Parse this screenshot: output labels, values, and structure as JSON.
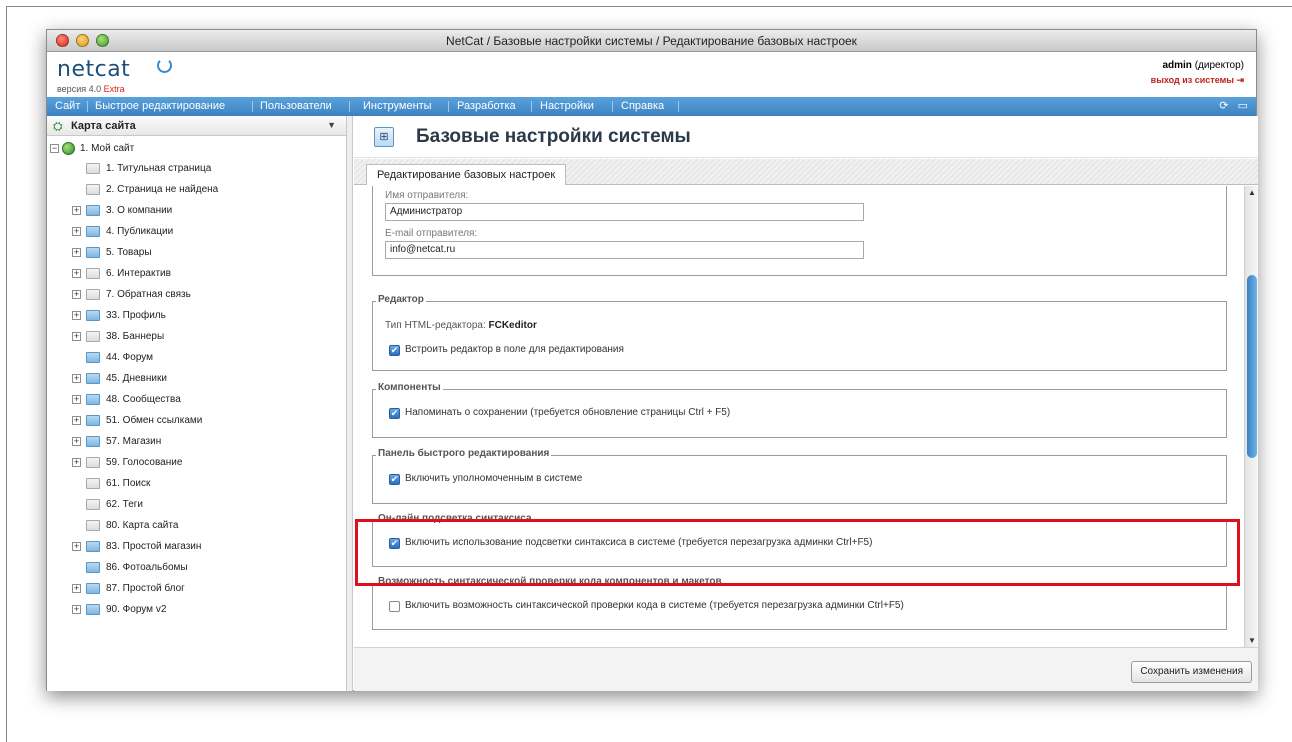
{
  "window": {
    "title": "NetCat / Базовые настройки системы / Редактирование базовых настроек"
  },
  "header": {
    "logo": "netcat",
    "version_prefix": "версия 4.0",
    "version_edition": "Extra",
    "user_name": "admin",
    "user_role": "(директор)",
    "logout_label": "выход из системы"
  },
  "nav": {
    "items": [
      "Сайт",
      "Быстрое редактирование",
      "Пользователи",
      "Инструменты",
      "Разработка",
      "Настройки",
      "Справка"
    ],
    "refresh_icon": "refresh-icon",
    "chat_icon": "chat-icon"
  },
  "sidebar": {
    "title": "Карта сайта",
    "root": "1. Мой сайт",
    "items": [
      {
        "label": "1. Титульная страница",
        "expandable": false,
        "active": false
      },
      {
        "label": "2. Страница не найдена",
        "expandable": false,
        "active": false
      },
      {
        "label": "3. О компании",
        "expandable": true,
        "active": true
      },
      {
        "label": "4. Публикации",
        "expandable": true,
        "active": true
      },
      {
        "label": "5. Товары",
        "expandable": true,
        "active": true
      },
      {
        "label": "6. Интерактив",
        "expandable": true,
        "active": false
      },
      {
        "label": "7. Обратная связь",
        "expandable": true,
        "active": false
      },
      {
        "label": "33. Профиль",
        "expandable": true,
        "active": true
      },
      {
        "label": "38. Баннеры",
        "expandable": true,
        "active": false
      },
      {
        "label": "44. Форум",
        "expandable": false,
        "active": true
      },
      {
        "label": "45. Дневники",
        "expandable": true,
        "active": true
      },
      {
        "label": "48. Сообщества",
        "expandable": true,
        "active": true
      },
      {
        "label": "51. Обмен ссылками",
        "expandable": true,
        "active": true
      },
      {
        "label": "57. Магазин",
        "expandable": true,
        "active": true
      },
      {
        "label": "59. Голосование",
        "expandable": true,
        "active": false
      },
      {
        "label": "61. Поиск",
        "expandable": false,
        "active": false
      },
      {
        "label": "62. Теги",
        "expandable": false,
        "active": false
      },
      {
        "label": "80. Карта сайта",
        "expandable": false,
        "active": false
      },
      {
        "label": "83. Простой магазин",
        "expandable": true,
        "active": true
      },
      {
        "label": "86. Фотоальбомы",
        "expandable": false,
        "active": true
      },
      {
        "label": "87. Простой блог",
        "expandable": true,
        "active": true
      },
      {
        "label": "90. Форум v2",
        "expandable": true,
        "active": true
      }
    ]
  },
  "main": {
    "title": "Базовые настройки системы",
    "tab": "Редактирование базовых настроек",
    "sender_name_label": "Имя отправителя:",
    "sender_name_value": "Администратор",
    "sender_email_label": "E-mail отправителя:",
    "sender_email_value": "info@netcat.ru",
    "editor_legend": "Редактор",
    "editor_type_label": "Тип HTML-редактора:",
    "editor_type_value": "FCKeditor",
    "editor_embed_label": "Встроить редактор в поле для редактирования",
    "components_legend": "Компоненты",
    "components_remind_label": "Напоминать о сохранении (требуется обновление страницы Ctrl + F5)",
    "quickedit_legend": "Панель быстрого редактирования",
    "quickedit_enable_label": "Включить уполномоченным в системе",
    "syntax_legend": "Он-лайн подсветка синтаксиса",
    "syntax_enable_label": "Включить использование подсветки синтаксиса в системе (требуется перезагрузка админки Ctrl+F5)",
    "syntaxcheck_legend": "Возможность синтаксической проверки кода компонентов и макетов",
    "syntaxcheck_enable_label": "Включить возможность синтаксической проверки кода в системе (требуется перезагрузка админки Ctrl+F5)",
    "save_label": "Сохранить изменения"
  },
  "colors": {
    "accent": "#3c82c2",
    "highlight": "#e0101a",
    "brand": "#1e4f7b"
  }
}
